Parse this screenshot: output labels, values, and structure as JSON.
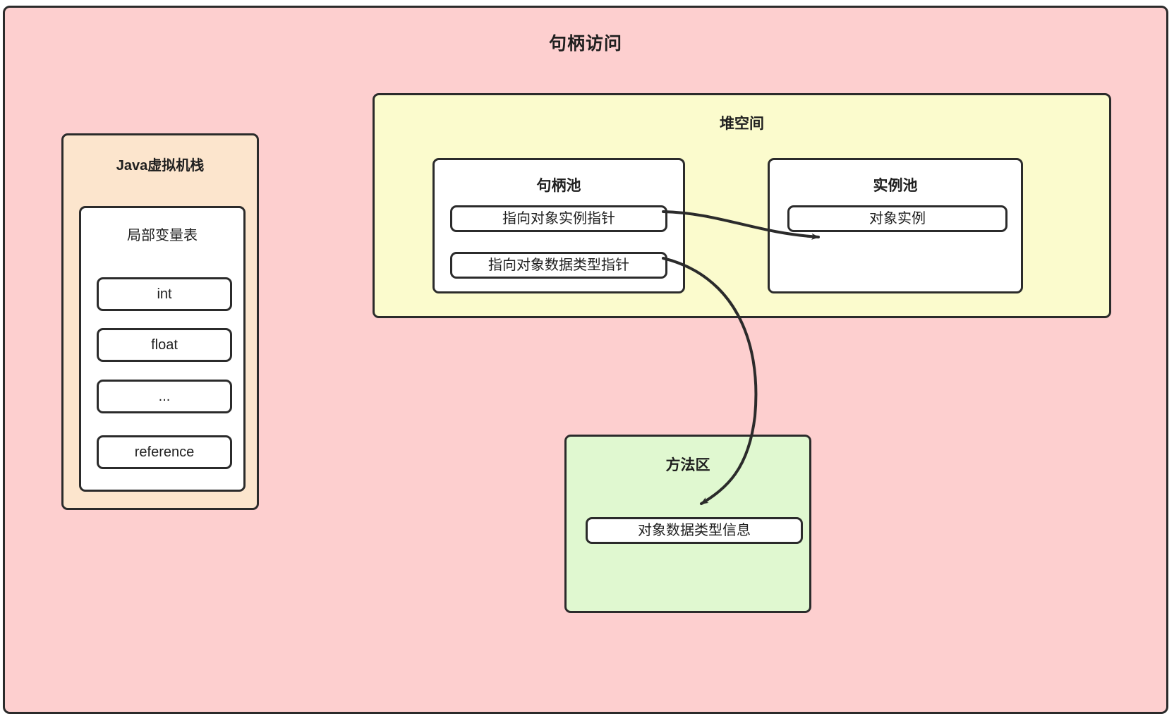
{
  "diagram": {
    "title": "句柄访问",
    "colors": {
      "outer_background": "#fdcfcf",
      "stack_background": "#fce5cd",
      "heap_background": "#fbfbcd",
      "method_area_background": "#e0f8d0",
      "box_background": "#ffffff",
      "stroke": "#2b2b2b"
    }
  },
  "jvm_stack": {
    "title": "Java虚拟机栈",
    "local_variable_table": {
      "title": "局部变量表",
      "slots": [
        {
          "label": "int"
        },
        {
          "label": "float"
        },
        {
          "label": "..."
        },
        {
          "label": "reference"
        }
      ]
    }
  },
  "heap": {
    "title": "堆空间",
    "handle_pool": {
      "title": "句柄池",
      "rows": [
        {
          "label": "指向对象实例指针"
        },
        {
          "label": "指向对象数据类型指针"
        }
      ]
    },
    "instance_pool": {
      "title": "实例池",
      "rows": [
        {
          "label": "对象实例"
        }
      ]
    }
  },
  "method_area": {
    "title": "方法区",
    "rows": [
      {
        "label": "对象数据类型信息"
      }
    ]
  },
  "connections": [
    {
      "name": "handle-to-instance",
      "from": "指向对象实例指针",
      "to": "对象实例"
    },
    {
      "name": "handle-to-type-info",
      "from": "指向对象数据类型指针",
      "to": "对象数据类型信息"
    }
  ]
}
